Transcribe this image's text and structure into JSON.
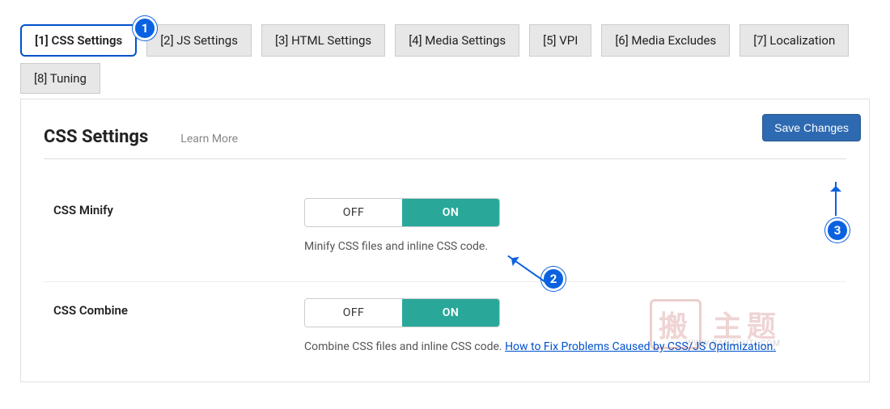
{
  "tabs": {
    "row": [
      "[1] CSS Settings",
      "[2] JS Settings",
      "[3] HTML Settings",
      "[4] Media Settings",
      "[5] VPI",
      "[6] Media Excludes",
      "[7] Localization",
      "[8] Tuning"
    ],
    "active_index": 0
  },
  "panel": {
    "title": "CSS Settings",
    "learn_more": "Learn More",
    "save_button": "Save Changes"
  },
  "settings": {
    "css_minify": {
      "label": "CSS Minify",
      "off": "OFF",
      "on": "ON",
      "state": "on",
      "description": "Minify CSS files and inline CSS code."
    },
    "css_combine": {
      "label": "CSS Combine",
      "off": "OFF",
      "on": "ON",
      "state": "on",
      "description_prefix": "Combine CSS files and inline CSS code. ",
      "help_link": "How to Fix Problems Caused by CSS/JS Optimization."
    }
  },
  "annotations": {
    "b1": "1",
    "b2": "2",
    "b3": "3"
  },
  "watermark": {
    "stamp": "搬",
    "text": "主题",
    "sub": "WWW.BANZHUTI.COM"
  }
}
